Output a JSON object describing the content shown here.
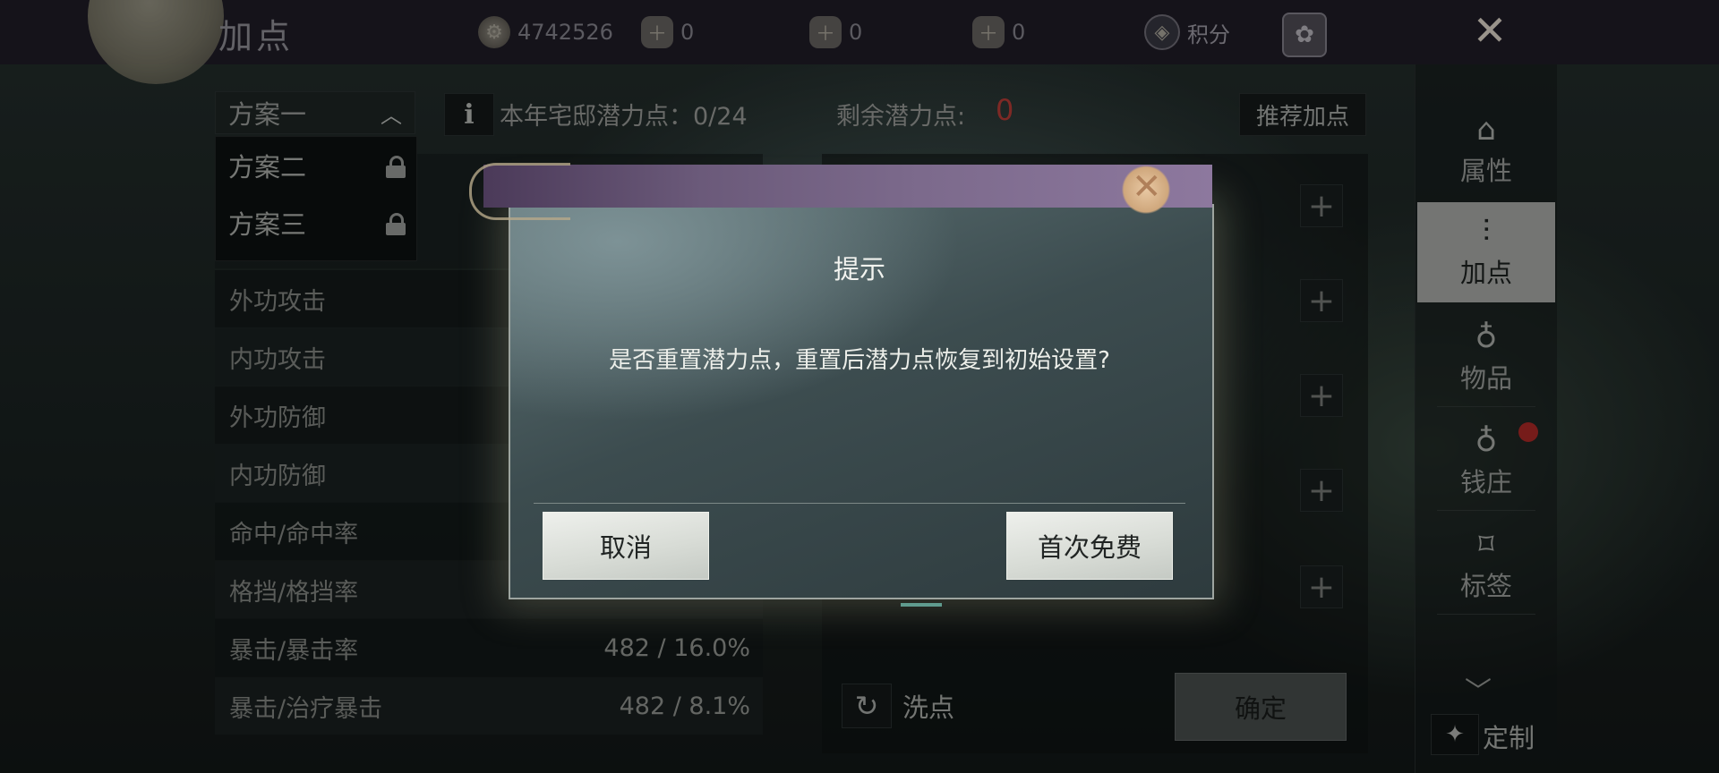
{
  "header": {
    "title": "加点",
    "resources": [
      {
        "icon": "copper-coin-icon",
        "value": "4742526"
      },
      {
        "icon": "silver-bag-icon",
        "value": "0"
      },
      {
        "icon": "token-icon",
        "value": "0"
      },
      {
        "icon": "gold-bag-icon",
        "value": "0"
      }
    ],
    "score_label": "积分"
  },
  "scheme": {
    "selected": "方案一",
    "options": [
      {
        "label": "方案二",
        "locked": true
      },
      {
        "label": "方案三",
        "locked": true
      }
    ]
  },
  "potential": {
    "year_label": "本年宅邸潜力点：0/24",
    "remaining_label": "剩余潜力点:",
    "remaining_value": "0",
    "recommend_button": "推荐加点"
  },
  "stats": [
    {
      "name": "外功攻击",
      "value": ""
    },
    {
      "name": "内功攻击",
      "value": ""
    },
    {
      "name": "外功防御",
      "value": ""
    },
    {
      "name": "内功防御",
      "value": ""
    },
    {
      "name": "命中/命中率",
      "value": ""
    },
    {
      "name": "格挡/格挡率",
      "value": ""
    },
    {
      "name": "暴击/暴击率",
      "value": "482 / 16.0%"
    },
    {
      "name": "暴击/治疗暴击",
      "value": "482 / 8.1%"
    }
  ],
  "actions": {
    "reset_label": "洗点",
    "confirm_label": "确定"
  },
  "tabs": [
    {
      "label": "属性",
      "icon": "hat-icon",
      "active": false
    },
    {
      "label": "加点",
      "icon": "sliders-icon",
      "active": true
    },
    {
      "label": "物品",
      "icon": "pouch-icon",
      "active": false
    },
    {
      "label": "钱庄",
      "icon": "money-bag-icon",
      "active": false,
      "badge": true
    },
    {
      "label": "标签",
      "icon": "tag-icon",
      "active": false
    }
  ],
  "custom_label": "定制",
  "dialog": {
    "title": "提示",
    "message": "是否重置潜力点，重置后潜力点恢复到初始设置?",
    "cancel_label": "取消",
    "confirm_label": "首次免费"
  },
  "colors": {
    "remaining_value": "#c6403a",
    "active_tab_bg": "#b6b8b5",
    "badge": "#b92c2a"
  }
}
